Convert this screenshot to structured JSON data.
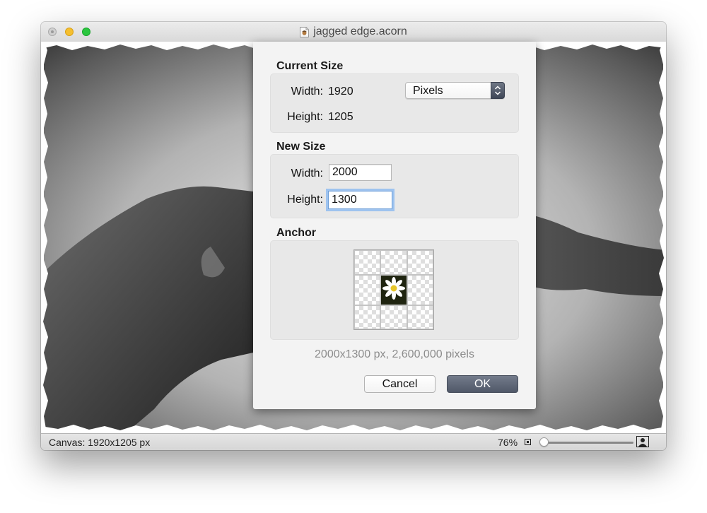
{
  "window": {
    "title": "jagged edge.acorn"
  },
  "status_bar": {
    "canvas_info": "Canvas: 1920x1205 px",
    "zoom_percent": "76%",
    "zoom_level": 0.03
  },
  "dialog": {
    "current_size": {
      "heading": "Current Size",
      "width_label": "Width:",
      "width_value": "1920",
      "height_label": "Height:",
      "height_value": "1205",
      "unit_selected": "Pixels"
    },
    "new_size": {
      "heading": "New Size",
      "width_label": "Width:",
      "width_value": "2000",
      "height_label": "Height:",
      "height_value": "1300"
    },
    "anchor": {
      "heading": "Anchor",
      "selected_cell": "center"
    },
    "summary": "2000x1300 px, 2,600,000 pixels",
    "cancel_label": "Cancel",
    "ok_label": "OK"
  },
  "colors": {
    "ok_button": "#5a6272",
    "focus_ring": "#9ec3ef",
    "traffic_close": "#d0d0d0",
    "traffic_minimize": "#f5bf2f",
    "traffic_zoom": "#2bc63f"
  }
}
